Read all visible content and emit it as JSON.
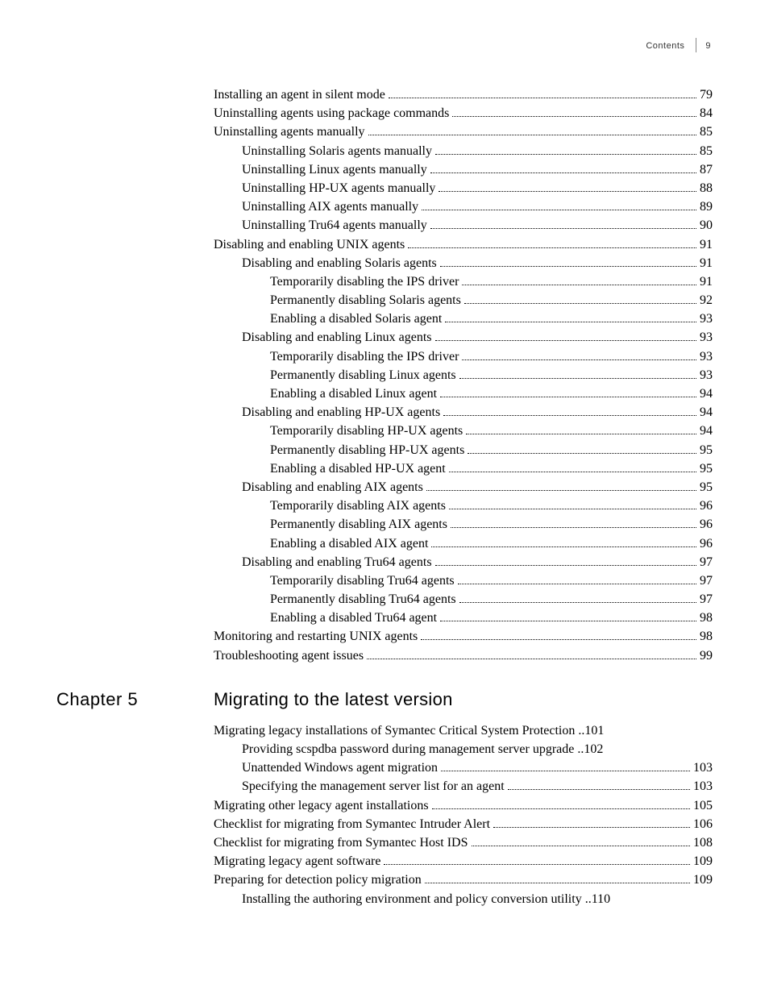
{
  "header": {
    "label": "Contents",
    "pagenum": "9"
  },
  "toc_top": [
    {
      "indent": 0,
      "label": "Installing an agent in silent mode",
      "page": "79"
    },
    {
      "indent": 0,
      "label": "Uninstalling agents using package commands",
      "page": "84"
    },
    {
      "indent": 0,
      "label": "Uninstalling agents manually",
      "page": "85"
    },
    {
      "indent": 1,
      "label": "Uninstalling Solaris agents manually",
      "page": "85"
    },
    {
      "indent": 1,
      "label": "Uninstalling Linux agents manually",
      "page": "87"
    },
    {
      "indent": 1,
      "label": "Uninstalling HP-UX agents manually",
      "page": "88"
    },
    {
      "indent": 1,
      "label": "Uninstalling AIX agents manually",
      "page": "89"
    },
    {
      "indent": 1,
      "label": "Uninstalling Tru64 agents manually",
      "page": "90"
    },
    {
      "indent": 0,
      "label": "Disabling and enabling UNIX agents",
      "page": "91"
    },
    {
      "indent": 1,
      "label": "Disabling and enabling Solaris agents",
      "page": "91"
    },
    {
      "indent": 2,
      "label": "Temporarily disabling the IPS driver",
      "page": "91"
    },
    {
      "indent": 2,
      "label": "Permanently disabling Solaris agents",
      "page": "92"
    },
    {
      "indent": 2,
      "label": "Enabling a disabled Solaris agent",
      "page": "93"
    },
    {
      "indent": 1,
      "label": "Disabling and enabling Linux agents",
      "page": "93"
    },
    {
      "indent": 2,
      "label": "Temporarily disabling the IPS driver",
      "page": "93"
    },
    {
      "indent": 2,
      "label": "Permanently disabling Linux agents",
      "page": "93"
    },
    {
      "indent": 2,
      "label": "Enabling a disabled Linux agent",
      "page": "94"
    },
    {
      "indent": 1,
      "label": "Disabling and enabling HP-UX agents",
      "page": "94"
    },
    {
      "indent": 2,
      "label": "Temporarily disabling HP-UX agents",
      "page": "94"
    },
    {
      "indent": 2,
      "label": "Permanently disabling HP-UX agents",
      "page": "95"
    },
    {
      "indent": 2,
      "label": "Enabling a disabled HP-UX agent",
      "page": "95"
    },
    {
      "indent": 1,
      "label": "Disabling and enabling AIX agents",
      "page": "95"
    },
    {
      "indent": 2,
      "label": "Temporarily disabling AIX agents",
      "page": "96"
    },
    {
      "indent": 2,
      "label": "Permanently disabling AIX agents",
      "page": "96"
    },
    {
      "indent": 2,
      "label": "Enabling a disabled AIX agent",
      "page": "96"
    },
    {
      "indent": 1,
      "label": "Disabling and enabling Tru64 agents",
      "page": "97"
    },
    {
      "indent": 2,
      "label": "Temporarily disabling Tru64 agents",
      "page": "97"
    },
    {
      "indent": 2,
      "label": "Permanently disabling Tru64 agents",
      "page": "97"
    },
    {
      "indent": 2,
      "label": "Enabling a disabled Tru64 agent",
      "page": "98"
    },
    {
      "indent": 0,
      "label": "Monitoring and restarting UNIX agents",
      "page": "98"
    },
    {
      "indent": 0,
      "label": "Troubleshooting agent issues",
      "page": "99"
    }
  ],
  "chapter": {
    "label": "Chapter 5",
    "title": "Migrating to the latest version"
  },
  "toc_chapter": [
    {
      "indent": 0,
      "label": "Migrating legacy installations of Symantec Critical System Protection",
      "page": "101",
      "tight": true
    },
    {
      "indent": 1,
      "label": "Providing scspdba password during management server upgrade",
      "page": "102",
      "tight": true
    },
    {
      "indent": 1,
      "label": "Unattended Windows agent migration",
      "page": "103"
    },
    {
      "indent": 1,
      "label": "Specifying the management server list for an agent",
      "page": "103"
    },
    {
      "indent": 0,
      "label": "Migrating other legacy agent installations",
      "page": "105"
    },
    {
      "indent": 0,
      "label": "Checklist for migrating from Symantec Intruder Alert",
      "page": "106"
    },
    {
      "indent": 0,
      "label": "Checklist for migrating from Symantec Host IDS",
      "page": "108"
    },
    {
      "indent": 0,
      "label": "Migrating legacy agent software",
      "page": "109"
    },
    {
      "indent": 0,
      "label": "Preparing for detection policy migration",
      "page": "109"
    },
    {
      "indent": 1,
      "label": "Installing the authoring environment and policy conversion utility",
      "page": "110",
      "tight": true
    }
  ]
}
